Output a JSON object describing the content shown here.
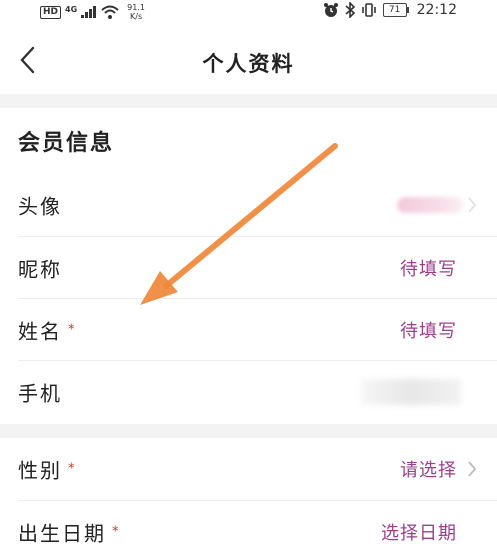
{
  "status_bar": {
    "hd": "HD",
    "network": "4G",
    "speed_value": "91.1",
    "speed_unit": "K/s",
    "battery": "71",
    "time": "22:12"
  },
  "header": {
    "title": "个人资料"
  },
  "member_section": {
    "title": "会员信息",
    "rows": [
      {
        "label": "头像",
        "value": "",
        "required": false
      },
      {
        "label": "昵称",
        "value": "待填写",
        "required": false
      },
      {
        "label": "姓名",
        "value": "待填写",
        "required": true
      },
      {
        "label": "手机",
        "value": "",
        "required": false
      }
    ]
  },
  "profile_section": {
    "rows": [
      {
        "label": "性别",
        "value": "请选择",
        "required": true
      },
      {
        "label": "出生日期",
        "value": "选择日期",
        "required": true
      }
    ]
  },
  "required_mark": "*",
  "colors": {
    "accent": "#9b3f8b",
    "required": "#c0392b",
    "annotation_arrow": "#f0883a",
    "section_gap": "#f3f3f3"
  },
  "icons": {
    "back": "chevron-left-icon",
    "row_chevron": "chevron-right-icon",
    "annotation": "arrow-annotation"
  }
}
